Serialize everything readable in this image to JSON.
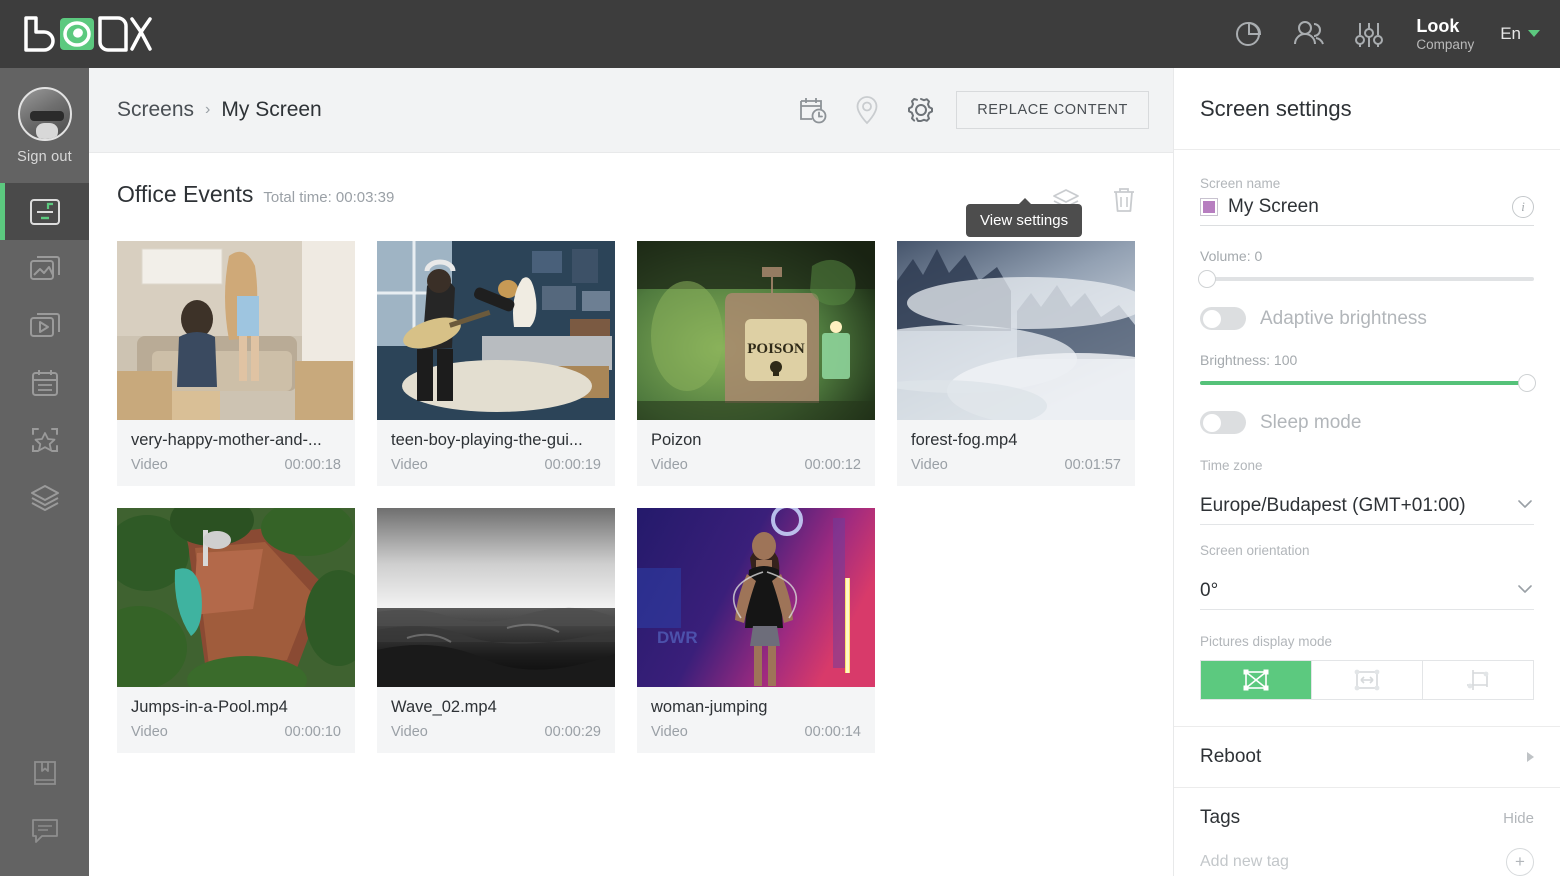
{
  "header": {
    "logo_text": "LOOK",
    "brand_name": "Look",
    "brand_sub": "Company",
    "language": "En",
    "icons": [
      {
        "name": "analytics-pie-icon"
      },
      {
        "name": "users-icon"
      },
      {
        "name": "sliders-icon"
      }
    ]
  },
  "sidebar": {
    "sign_out": "Sign out",
    "items": [
      {
        "name": "screens",
        "icon": "screen-icon",
        "active": true
      },
      {
        "name": "gallery",
        "icon": "images-icon",
        "active": false
      },
      {
        "name": "playlists",
        "icon": "video-playlist-icon",
        "active": false
      },
      {
        "name": "schedule",
        "icon": "calendar-icon",
        "active": false
      },
      {
        "name": "widgets",
        "icon": "star-frame-icon",
        "active": false
      },
      {
        "name": "layers",
        "icon": "layers-icon",
        "active": false
      }
    ],
    "bottom_items": [
      {
        "name": "bookmark",
        "icon": "book-icon"
      },
      {
        "name": "support-chat",
        "icon": "chat-icon"
      }
    ]
  },
  "breadcrumb": {
    "root": "Screens",
    "separator": "›",
    "current": "My Screen"
  },
  "toolbar": {
    "schedule_icon": "calendar-clock-icon",
    "location_icon": "location-pin-icon",
    "settings_icon": "gear-icon",
    "replace_content": "REPLACE CONTENT",
    "tooltip": "View settings"
  },
  "playlist": {
    "title": "Office Events",
    "total_time_label": "Total time: 00:03:39",
    "layers_icon": "layers-stack-icon",
    "delete_icon": "trash-icon",
    "items": [
      {
        "title": "very-happy-mother-and-...",
        "type": "Video",
        "duration": "00:00:18",
        "thumb": "living-room"
      },
      {
        "title": "teen-boy-playing-the-gui...",
        "type": "Video",
        "duration": "00:00:19",
        "thumb": "guitar-room"
      },
      {
        "title": "Poizon",
        "type": "Video",
        "duration": "00:00:12",
        "thumb": "poison-bottle"
      },
      {
        "title": "forest-fog.mp4",
        "type": "Video",
        "duration": "00:01:57",
        "thumb": "forest-fog"
      },
      {
        "title": "Jumps-in-a-Pool.mp4",
        "type": "Video",
        "duration": "00:00:10",
        "thumb": "aerial-pool"
      },
      {
        "title": "Wave_02.mp4",
        "type": "Video",
        "duration": "00:00:29",
        "thumb": "ocean-wave"
      },
      {
        "title": "woman-jumping",
        "type": "Video",
        "duration": "00:00:14",
        "thumb": "woman-neon"
      }
    ]
  },
  "settings": {
    "panel_title": "Screen settings",
    "screen_name_label": "Screen name",
    "screen_name_value": "My Screen",
    "screen_name_color": "#b77ec0",
    "info_glyph": "i",
    "volume_label": "Volume: 0",
    "volume_percent": 0,
    "adaptive_brightness_label": "Adaptive brightness",
    "adaptive_brightness_on": false,
    "brightness_label": "Brightness: 100",
    "brightness_percent": 100,
    "brightness_color": "#55c279",
    "sleep_mode_label": "Sleep mode",
    "sleep_mode_on": false,
    "time_zone_label": "Time zone",
    "time_zone_value": "Europe/Budapest (GMT+01:00)",
    "orientation_label": "Screen orientation",
    "orientation_value": "0°",
    "pictures_mode_label": "Pictures display mode",
    "pictures_modes": [
      {
        "name": "fit-stretch",
        "active": true
      },
      {
        "name": "fit-width",
        "active": false
      },
      {
        "name": "fit-crop",
        "active": false
      }
    ],
    "reboot_label": "Reboot",
    "tags_label": "Tags",
    "tags_hide": "Hide",
    "add_new_tag": "Add new tag",
    "add_tag_plus": "+",
    "accent_color": "#5cc97f"
  }
}
